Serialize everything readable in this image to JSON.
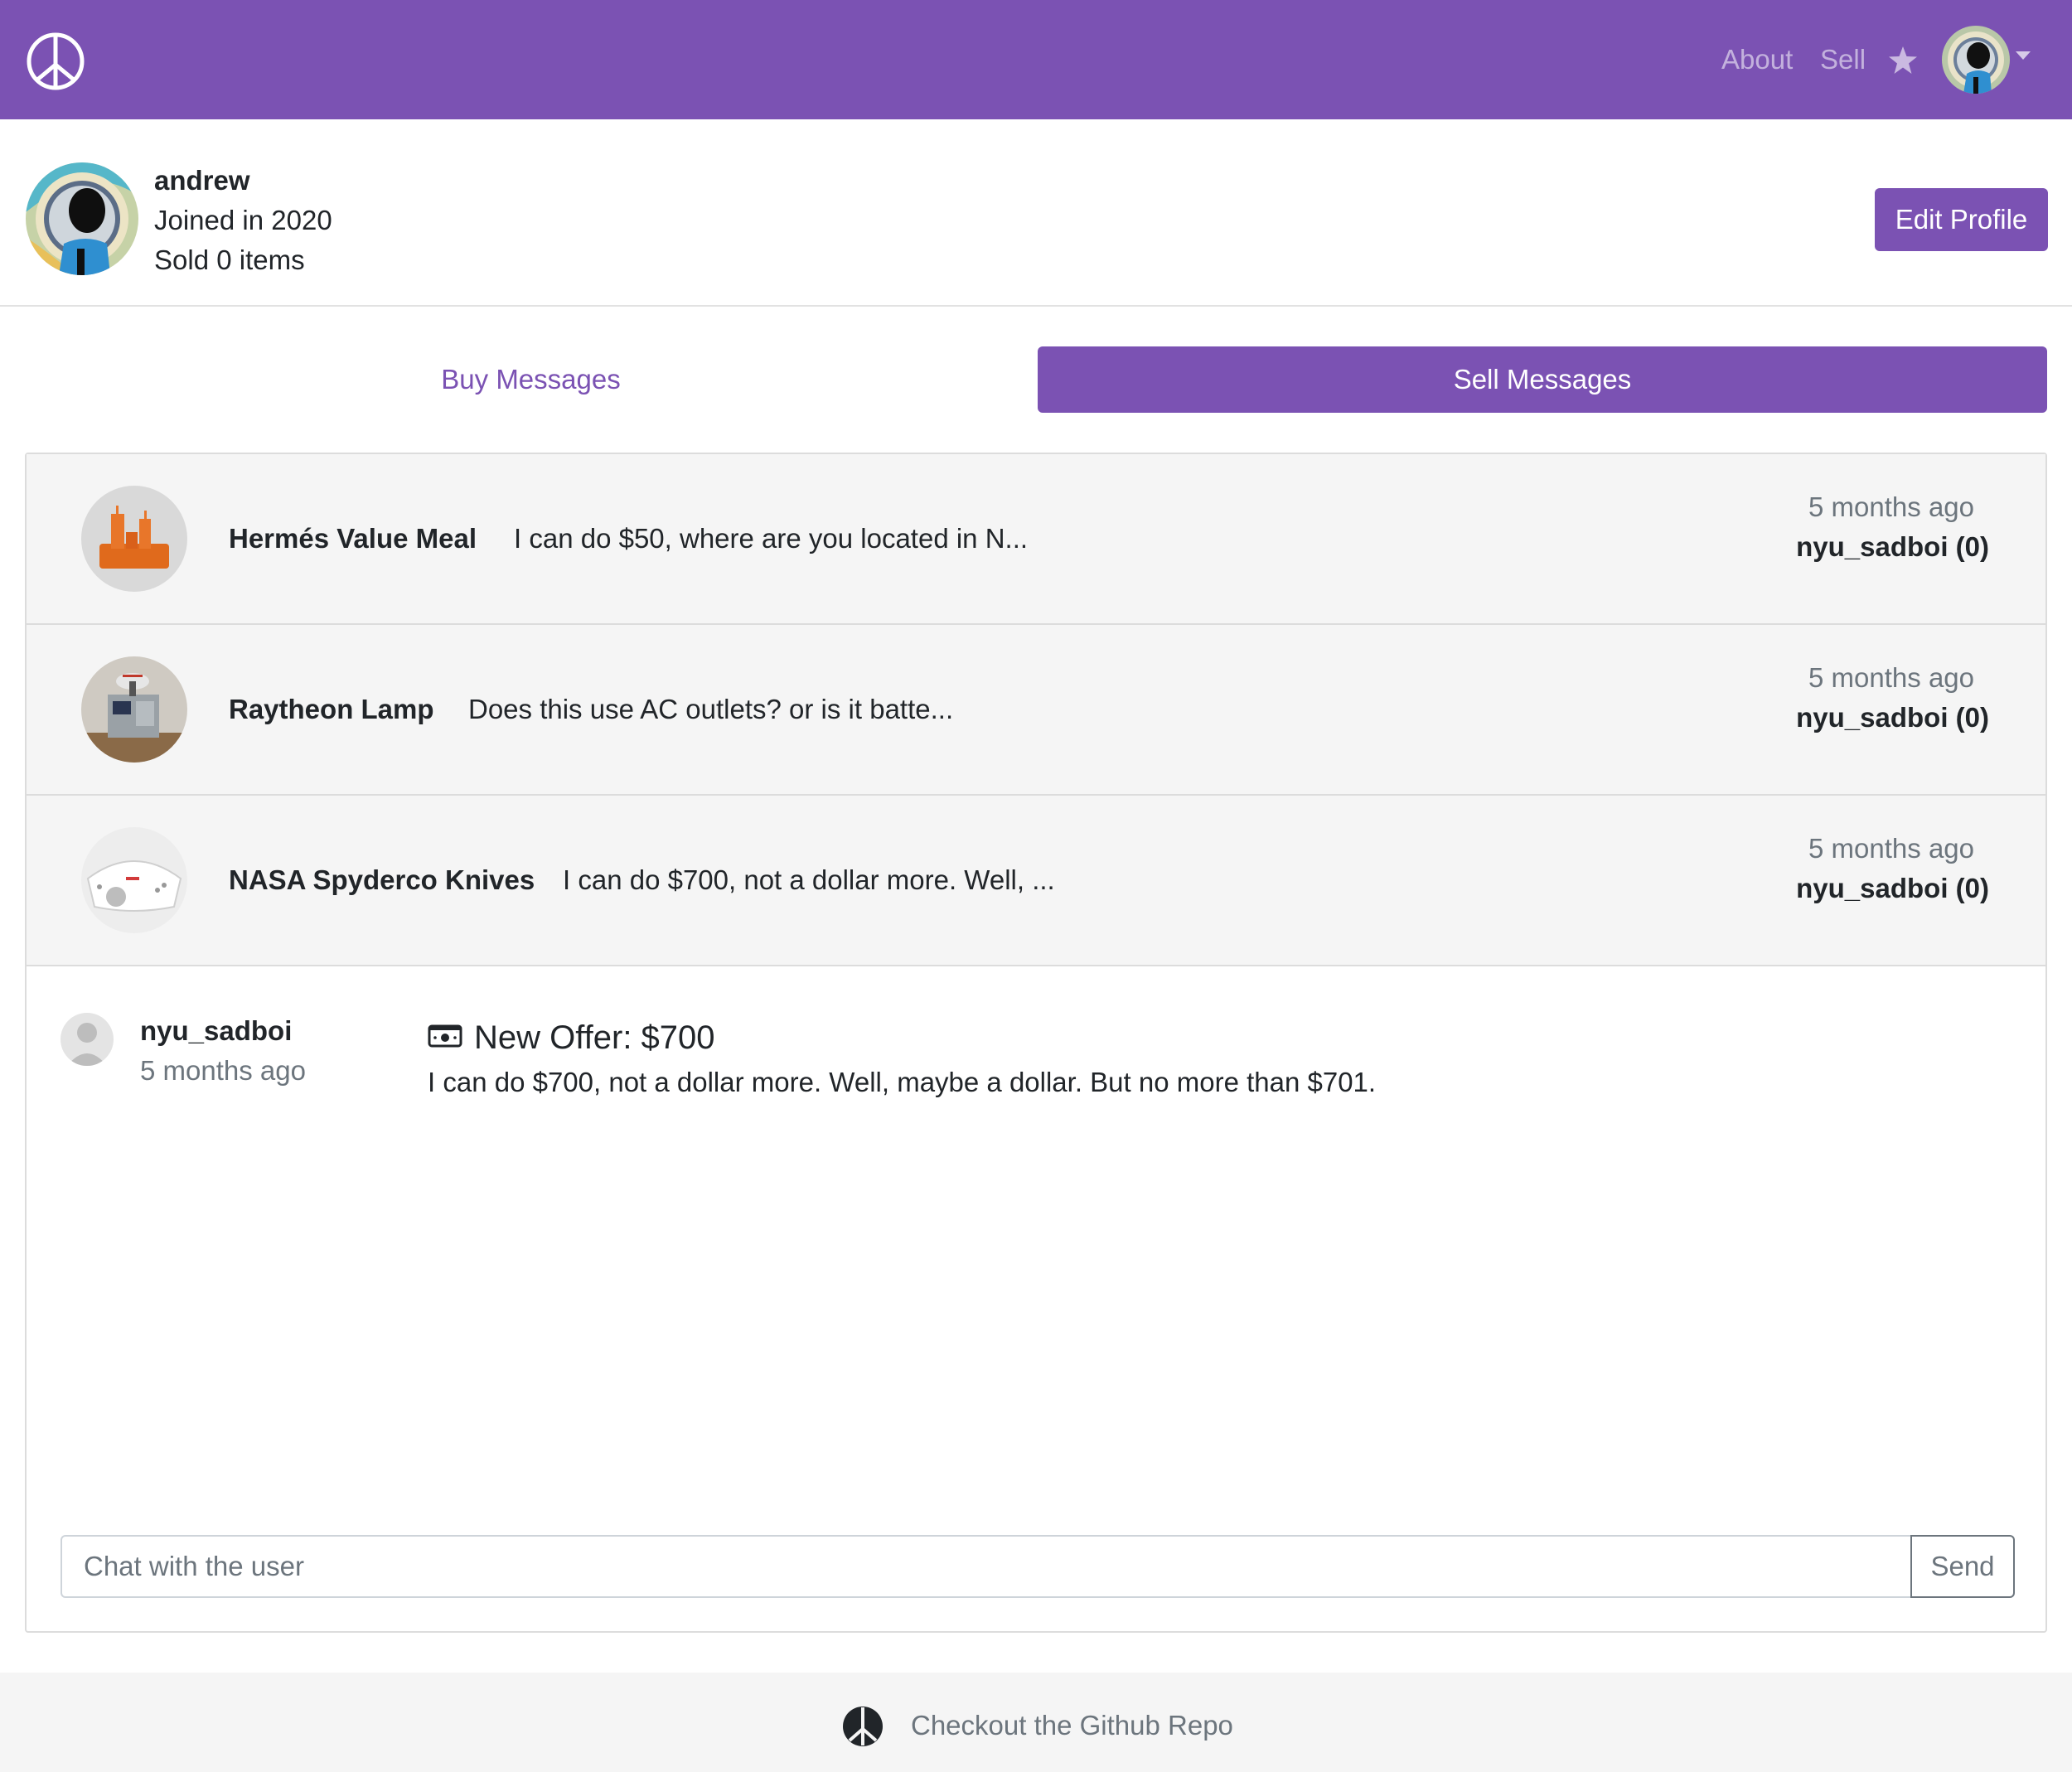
{
  "navbar": {
    "logo_icon": "peace-sign-icon",
    "links": {
      "about": "About",
      "sell": "Sell"
    },
    "favorites_icon": "star-icon",
    "user_menu_icon": "chevron-down-icon",
    "brand_color": "#7b52b3"
  },
  "profile": {
    "username": "andrew",
    "joined": "Joined in 2020",
    "sold": "Sold 0 items",
    "edit_label": "Edit Profile"
  },
  "tabs": {
    "buy": "Buy Messages",
    "sell": "Sell Messages",
    "active": "sell"
  },
  "conversations": [
    {
      "item": "Hermés Value Meal",
      "preview": "I can do $50, where are you located in N...",
      "time": "5 months ago",
      "user": "nyu_sadboi (0)",
      "thumb": "orange-tray-meal"
    },
    {
      "item": "Raytheon Lamp",
      "preview": "Does this use AC outlets? or is it batte...",
      "time": "5 months ago",
      "user": "nyu_sadboi (0)",
      "thumb": "machine-lamp"
    },
    {
      "item": "NASA Spyderco Knives",
      "preview": "I can do $700, not a dollar more. Well, ...",
      "time": "5 months ago",
      "user": "nyu_sadboi (0)",
      "thumb": "white-knife-case"
    }
  ],
  "message": {
    "user": "nyu_sadboi",
    "time": "5 months ago",
    "offer_icon": "money-bill-icon",
    "offer_title": "New Offer: $700",
    "text": "I can do $700, not a dollar more. Well, maybe a dollar. But no more than $701."
  },
  "chat": {
    "placeholder": "Chat with the user",
    "send_label": "Send"
  },
  "footer": {
    "logo_icon": "peace-sign-icon",
    "link": "Checkout the Github Repo"
  }
}
